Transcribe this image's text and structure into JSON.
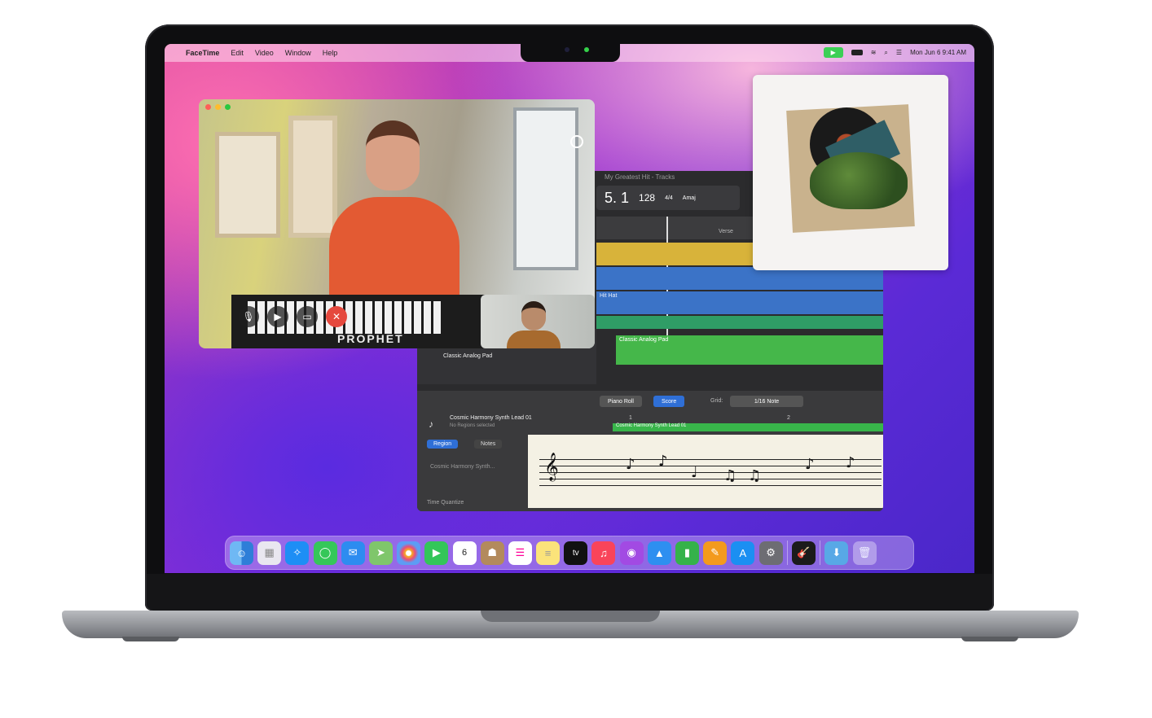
{
  "menubar": {
    "apple": "",
    "app": "FaceTime",
    "items": [
      "Edit",
      "Video",
      "Window",
      "Help"
    ],
    "clock": "Mon Jun 6  9:41 AM"
  },
  "facetime": {
    "keyboard_brand": "PROPHET"
  },
  "garageband": {
    "title": "My Greatest Hit - Tracks",
    "lcd": {
      "position": "5. 1",
      "tempo": "128",
      "signature": "4/4",
      "key": "Amaj"
    },
    "ruler": {
      "verse": "Verse"
    },
    "track_label_hit": "Hit Hat",
    "track_name": "Classic Analog Pad",
    "region_pad": "Classic Analog Pad",
    "editor": {
      "tab_piano": "Piano Roll",
      "tab_score": "Score",
      "grid_label": "Grid:",
      "grid_value": "1/16 Note",
      "instrument": "Cosmic Harmony Synth Lead 01",
      "no_regions": "No Regions selected",
      "btn_region": "Region",
      "btn_notes": "Notes",
      "instrument_field": "Cosmic Harmony Synth...",
      "time_quantize": "Time Quantize",
      "region_name": "Cosmic Harmony Synth Lead 01",
      "bar1": "1",
      "bar2": "2"
    }
  },
  "dock": {
    "apps": [
      "finder-icon",
      "launchpad-icon",
      "safari-icon",
      "messages-icon",
      "mail-icon",
      "maps-icon",
      "photos-icon",
      "facetime-icon",
      "calendar-icon",
      "contacts-icon",
      "reminders-icon",
      "notes-icon",
      "tv-icon",
      "music-icon",
      "podcasts-icon",
      "keynote-icon",
      "numbers-icon",
      "pages-icon",
      "app-store-icon",
      "system-preferences-icon",
      "garageband-icon",
      "downloads-icon",
      "trash-icon"
    ],
    "calendar_day": "6",
    "tv_label": "tv"
  }
}
